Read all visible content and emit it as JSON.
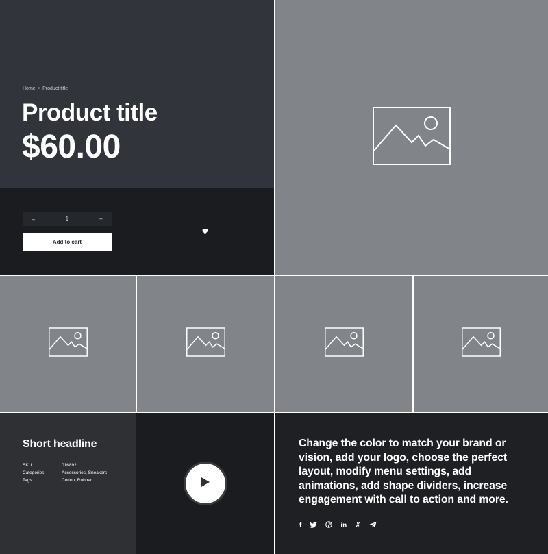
{
  "breadcrumb": {
    "home": "Home",
    "separator": "•",
    "current": "Product title"
  },
  "product": {
    "title": "Product title",
    "price": "$60.00"
  },
  "cart": {
    "minus": "–",
    "quantity": "1",
    "plus": "+",
    "add_label": "Add to cart"
  },
  "wishlist": {
    "icon": "heart-icon"
  },
  "images": {
    "icon": "image-placeholder-icon",
    "thumbnail_count": 4
  },
  "details": {
    "headline": "Short headline",
    "rows": [
      {
        "key": "SKU",
        "value": "016892"
      },
      {
        "key": "Categories",
        "value": "Accessories, Sneakers"
      },
      {
        "key": "Tags",
        "value": "Cotton, Rubber"
      }
    ]
  },
  "video": {
    "icon": "play-icon"
  },
  "promo": {
    "text": "Change the color to match your brand or vision, add your logo, choose the perfect layout, modify menu settings, add animations, add shape dividers, increase engagement with call to action and more."
  },
  "social": [
    {
      "name": "facebook-icon",
      "glyph": "f"
    },
    {
      "name": "twitter-icon",
      "glyph": "🐦"
    },
    {
      "name": "pinterest-icon",
      "glyph": "℗"
    },
    {
      "name": "linkedin-icon",
      "glyph": "in"
    },
    {
      "name": "xing-icon",
      "glyph": "✗"
    },
    {
      "name": "telegram-icon",
      "glyph": "➤"
    }
  ],
  "colors": {
    "hero_bg": "#31343a",
    "dark_bg": "#1a1c1f",
    "image_bg": "#81858a",
    "meta_bg": "#2f3033",
    "promo_bg": "#1e2023"
  }
}
